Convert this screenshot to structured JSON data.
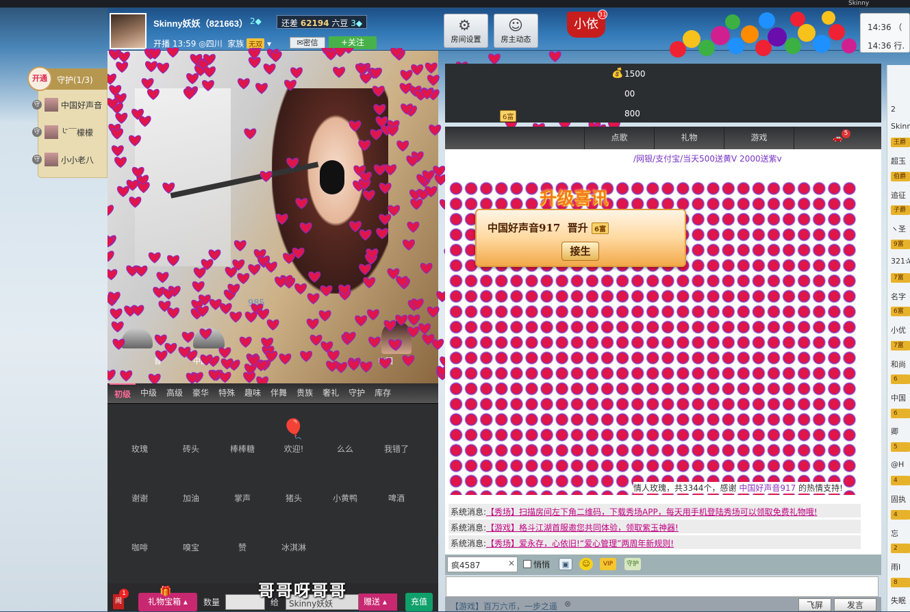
{
  "topbar": {
    "user": "Skinny"
  },
  "header": {
    "name": "Skinny妖妖（821663）",
    "level": "2",
    "cost_prefix": "还差",
    "cost_value": "62194",
    "cost_suffix": "六豆",
    "cost_level": "3",
    "meta_prefix": "开播",
    "meta_time": "13:59",
    "meta_location": "四川",
    "meta_family_label": "家族",
    "meta_family_value": "无双",
    "msg_btn": "密信",
    "follow_btn": "+关注",
    "room_settings": "房间设置",
    "host_activity": "房主动态",
    "xiaoyi": "小依",
    "xiaoyi_count": "31"
  },
  "notifications": [
    {
      "time": "14:36",
      "text": "（"
    },
    {
      "time": "14:36",
      "text": "行."
    }
  ],
  "guard": {
    "open": "开通",
    "title": "守护(1/3)",
    "members": [
      "中国好声音",
      "╰ ̄￣檬檬",
      "小小老八"
    ],
    "badge": "守"
  },
  "video": {
    "ghost_number": "985",
    "guests": [
      "音",
      "中国好",
      "中国"
    ]
  },
  "gift_tabs": [
    "初级",
    "中级",
    "高级",
    "豪华",
    "特殊",
    "趣味",
    "伴舞",
    "贵族",
    "奢礼",
    "守护",
    "库存"
  ],
  "gifts": [
    "玫瑰",
    "砖头",
    "棒棒糖",
    "欢迎!",
    "么么",
    "我错了",
    "谢谢",
    "加油",
    "掌声",
    "猪头",
    "小黄鸭",
    "啤酒",
    "咖啡",
    "嗅宝",
    "赞",
    "冰淇淋"
  ],
  "gift_bar": {
    "badge": "1",
    "treasure": "礼物宝箱",
    "qty_label": "数量",
    "to_label": "给",
    "recipient": "Skinny妖妖",
    "send": "赠送",
    "charge": "充值"
  },
  "subtitle": "哥哥呀哥哥",
  "ranking": {
    "v1": "1500",
    "v2": "00",
    "v3": "800",
    "lvl": "6富"
  },
  "chat_tabs": [
    "点歌",
    "礼物",
    "游戏",
    ""
  ],
  "chat_tab_badge": "5",
  "promo": "/网银/支付宝/当天500送黄V 2000送紫v",
  "levelup": {
    "title": "升级喜讯",
    "user": "中国好声音917",
    "verb": "晋升",
    "level": "6富",
    "button": "接生"
  },
  "gift_thanks": {
    "prefix": "情人玫瑰，共3344个，感谢",
    "user": "中国好声音917",
    "suffix": "的热情支持!"
  },
  "system_messages": [
    {
      "label": "系统消息:",
      "link": "【秀场】扫描房间左下角二维码，下载秀场APP，每天用手机登陆秀场可以领取免费礼物哦!"
    },
    {
      "label": "系统消息:",
      "link": "【游戏】格斗江湖首服邀您共同体验，领取紫玉神器!"
    },
    {
      "label": "系统消息:",
      "link": "【秀场】爱永存，心依旧!“爱心管理”两周年新规则!"
    }
  ],
  "chat_input": {
    "name": "疯4587",
    "quiet": "悄悄",
    "vip": "VIP",
    "guard": "守护"
  },
  "footer": {
    "text": "【游戏】百万六币，一步之遥",
    "fullscreen": "飞屏",
    "send": "发言"
  },
  "right_list": [
    {
      "badge": "",
      "text": "2"
    },
    {
      "badge": "",
      "text": "Skinn"
    },
    {
      "badge": "王爵",
      "text": ""
    },
    {
      "badge": "",
      "text": "超玉"
    },
    {
      "badge": "伯爵",
      "text": ""
    },
    {
      "badge": "",
      "text": "追征"
    },
    {
      "badge": "子爵",
      "text": ""
    },
    {
      "badge": "",
      "text": "ヽ圣"
    },
    {
      "badge": "9富",
      "text": ""
    },
    {
      "badge": "",
      "text": "321✰"
    },
    {
      "badge": "7富",
      "text": ""
    },
    {
      "badge": "",
      "text": "名字"
    },
    {
      "badge": "6富",
      "text": ""
    },
    {
      "badge": "",
      "text": "小优"
    },
    {
      "badge": "7富",
      "text": ""
    },
    {
      "badge": "",
      "text": "和尚"
    },
    {
      "badge": "6",
      "text": ""
    },
    {
      "badge": "",
      "text": "中国"
    },
    {
      "badge": "6",
      "text": ""
    },
    {
      "badge": "",
      "text": "卿"
    },
    {
      "badge": "5",
      "text": ""
    },
    {
      "badge": "",
      "text": "@H"
    },
    {
      "badge": "4",
      "text": ""
    },
    {
      "badge": "",
      "text": "固执"
    },
    {
      "badge": "4",
      "text": ""
    },
    {
      "badge": "",
      "text": "忘"
    },
    {
      "badge": "2",
      "text": ""
    },
    {
      "badge": "",
      "text": "雨I"
    },
    {
      "badge": "8",
      "text": ""
    },
    {
      "badge": "",
      "text": "失眠"
    }
  ]
}
